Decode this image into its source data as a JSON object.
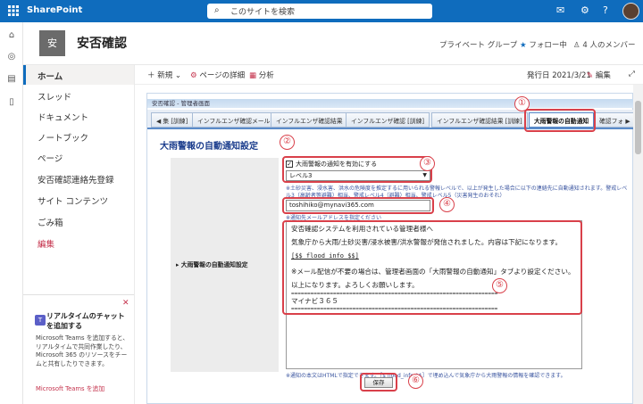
{
  "topbar": {
    "brand": "SharePoint",
    "search_placeholder": "このサイトを検索"
  },
  "site": {
    "logo_text": "安",
    "title": "安否確認",
    "privacy": "プライベート グループ",
    "follow": "フォロー中",
    "members": "4 人のメンバー"
  },
  "leftnav": {
    "items": [
      {
        "label": "ホーム"
      },
      {
        "label": "スレッド"
      },
      {
        "label": "ドキュメント"
      },
      {
        "label": "ノートブック"
      },
      {
        "label": "ページ"
      },
      {
        "label": "安否確認連絡先登録"
      },
      {
        "label": "サイト コンテンツ"
      },
      {
        "label": "ごみ箱"
      },
      {
        "label": "編集"
      }
    ]
  },
  "teams_card": {
    "title": "リアルタイムのチャットを追加する",
    "body": "Microsoft Teams を追加すると、リアルタイムで共同作業したり、Microsoft 365 のリソースをチームと共有したりできます。",
    "link": "Microsoft Teams を追加"
  },
  "commandbar": {
    "new": "新規",
    "page_details": "ページの詳細",
    "analytics": "分析",
    "published": "発行日 2021/3/21",
    "edit": "編集"
  },
  "app": {
    "strip_title": "安否確認 - 管理者画面",
    "tabs": [
      {
        "label": "◀ 集 [訓練]"
      },
      {
        "label": "インフルエンザ確認メール"
      },
      {
        "label": "インフルエンザ確認結果"
      },
      {
        "label": "インフルエンザ確認 [訓練]"
      },
      {
        "label": "インフルエンザ確認結果 [訓練]"
      },
      {
        "label": "大雨警報の自動通知"
      },
      {
        "label": "確認フォ ▶"
      }
    ],
    "section_title": "大雨警報の自動通知設定",
    "row_label": "▸ 大雨警報の自動通知設定",
    "enable_label": "大雨警報の通知を有効にする",
    "level_value": "レベル3",
    "level_note_1": "※土砂災害、浸水害、洪水の危険度を推定するに用いられる警報レベルで、以上が発生した場合に以下の連絡先に自動通知されます。警戒レベ",
    "level_note_2": "ル3（高齢者等避難）相当、警戒レベル4（避難）相当、警戒レベル5（災害発生のおそれ）",
    "email_value": "toshihiko@mynavi365.com",
    "email_note": "※通知先メールアドレスを指定ください",
    "message_lines": [
      "安否確認システムを利用されている管理者様へ",
      "気象庁から大雨/土砂災害/浸水被害/洪水警報が発信されました。内容は下記になります。",
      "[$$ flood_info $$]",
      "※メール配信が不要の場合は、管理者画面の「大雨警報の自動通知」タブより設定ください。",
      "以上になります。よろしくお願いします。",
      "================================================================",
      "マイナビ３６５",
      "================================================================"
    ],
    "body_note": "※通知の本文はHTMLで指定できます。［$ flood_info $$］で埋め込んで気象庁から大雨警報の情報を確認できます。",
    "save": "保存"
  },
  "annotations": [
    "①",
    "②",
    "③",
    "④",
    "⑤",
    "⑥"
  ]
}
